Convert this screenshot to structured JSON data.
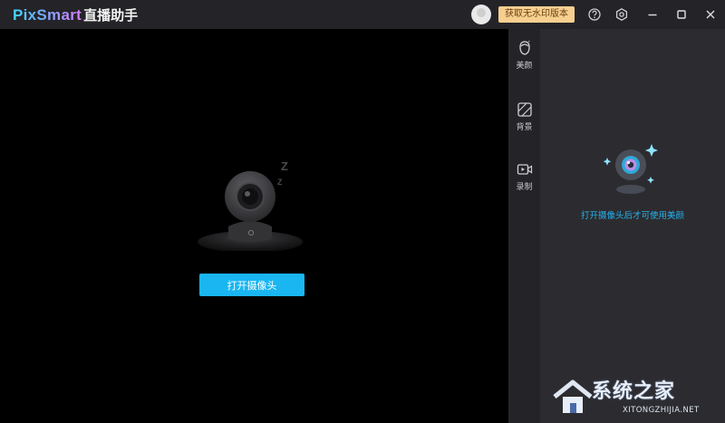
{
  "app": {
    "brand_en": "PixSmart",
    "brand_cn": "直播助手"
  },
  "titlebar": {
    "promo_label": "获取无水印版本",
    "help_icon": "question-circle-icon",
    "settings_icon": "gear-icon",
    "window_controls": [
      "minimize",
      "maximize",
      "close"
    ]
  },
  "stage": {
    "camera_icon": "sleeping-webcam-icon",
    "sleep_glyph": "Z",
    "open_camera_label": "打开摄像头"
  },
  "toolbar": {
    "items": [
      {
        "label": "美颜",
        "icon": "face-beauty-icon"
      },
      {
        "label": "背景",
        "icon": "background-icon"
      },
      {
        "label": "录制",
        "icon": "record-video-icon"
      }
    ]
  },
  "panel": {
    "hint": "打开摄像头后才可使用美颜"
  },
  "watermark": {
    "text": "系统之家",
    "sub": "XITONGZHIJIA.NET"
  },
  "colors": {
    "accent": "#19b6f2",
    "promo_bg": "#f7cf8f",
    "titlebar_bg": "#242428",
    "panel_bg": "#2c2c30"
  }
}
